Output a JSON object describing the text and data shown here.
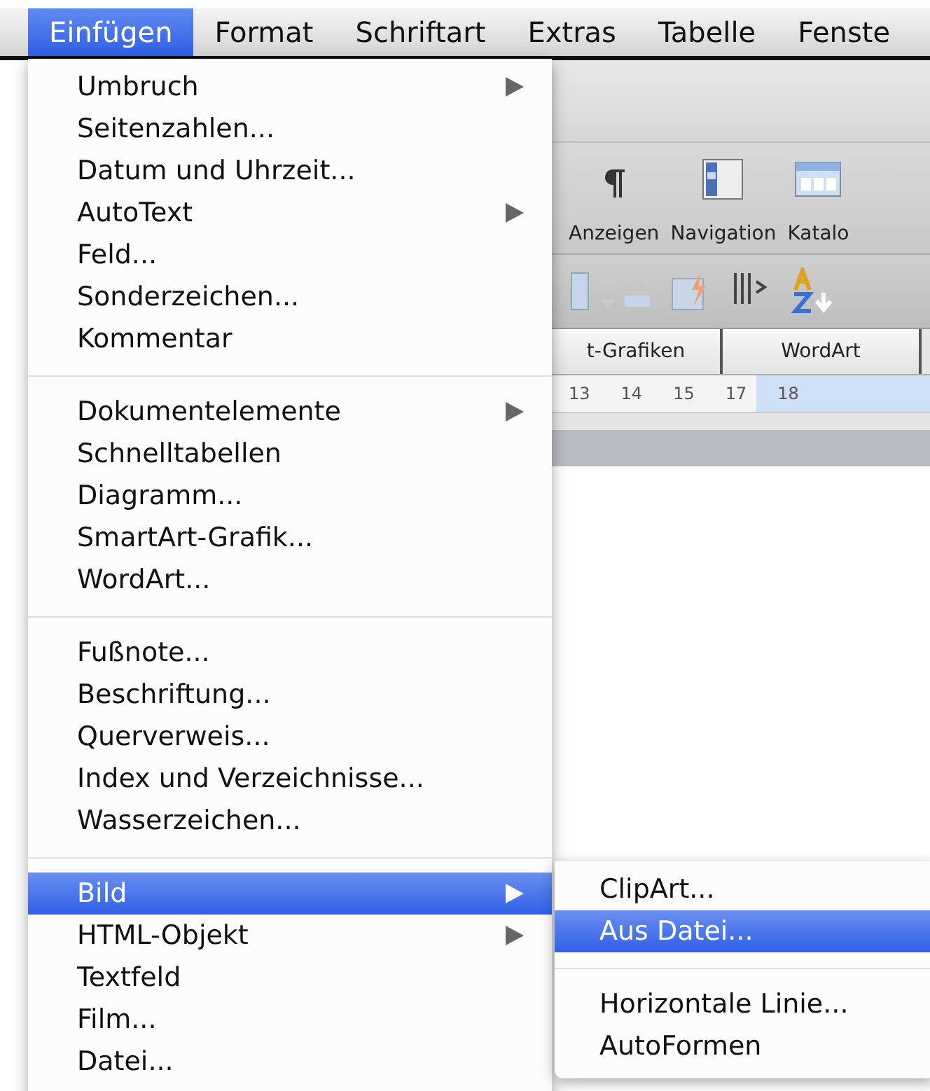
{
  "menubar": [
    {
      "label": "Einfügen",
      "selected": true
    },
    {
      "label": "Format",
      "selected": false
    },
    {
      "label": "Schriftart",
      "selected": false
    },
    {
      "label": "Extras",
      "selected": false
    },
    {
      "label": "Tabelle",
      "selected": false
    },
    {
      "label": "Fenste",
      "selected": false
    }
  ],
  "ribbon": {
    "buttons": [
      {
        "label": "Anzeigen"
      },
      {
        "label": "Navigation"
      },
      {
        "label": "Katalo"
      }
    ],
    "tabs": [
      "t-Grafiken",
      "WordArt"
    ],
    "ruler": [
      "13",
      "14",
      "15",
      "17",
      "18"
    ]
  },
  "menu": [
    {
      "kind": "item",
      "label": "Umbruch",
      "submenu": true,
      "selected": false
    },
    {
      "kind": "item",
      "label": "Seitenzahlen...",
      "submenu": false,
      "selected": false
    },
    {
      "kind": "item",
      "label": "Datum und Uhrzeit...",
      "submenu": false,
      "selected": false
    },
    {
      "kind": "item",
      "label": "AutoText",
      "submenu": true,
      "selected": false
    },
    {
      "kind": "item",
      "label": "Feld...",
      "submenu": false,
      "selected": false
    },
    {
      "kind": "item",
      "label": "Sonderzeichen...",
      "submenu": false,
      "selected": false
    },
    {
      "kind": "item",
      "label": "Kommentar",
      "submenu": false,
      "selected": false
    },
    {
      "kind": "separator"
    },
    {
      "kind": "item",
      "label": "Dokumentelemente",
      "submenu": true,
      "selected": false
    },
    {
      "kind": "item",
      "label": "Schnelltabellen",
      "submenu": false,
      "selected": false
    },
    {
      "kind": "item",
      "label": "Diagramm...",
      "submenu": false,
      "selected": false
    },
    {
      "kind": "item",
      "label": "SmartArt-Grafik...",
      "submenu": false,
      "selected": false
    },
    {
      "kind": "item",
      "label": "WordArt...",
      "submenu": false,
      "selected": false
    },
    {
      "kind": "separator"
    },
    {
      "kind": "item",
      "label": "Fußnote...",
      "submenu": false,
      "selected": false
    },
    {
      "kind": "item",
      "label": "Beschriftung...",
      "submenu": false,
      "selected": false
    },
    {
      "kind": "item",
      "label": "Querverweis...",
      "submenu": false,
      "selected": false
    },
    {
      "kind": "item",
      "label": "Index und Verzeichnisse...",
      "submenu": false,
      "selected": false
    },
    {
      "kind": "item",
      "label": "Wasserzeichen...",
      "submenu": false,
      "selected": false
    },
    {
      "kind": "separator"
    },
    {
      "kind": "item",
      "label": "Bild",
      "submenu": true,
      "selected": true
    },
    {
      "kind": "item",
      "label": "HTML-Objekt",
      "submenu": true,
      "selected": false
    },
    {
      "kind": "item",
      "label": "Textfeld",
      "submenu": false,
      "selected": false
    },
    {
      "kind": "item",
      "label": "Film...",
      "submenu": false,
      "selected": false
    },
    {
      "kind": "item",
      "label": "Datei...",
      "submenu": false,
      "selected": false
    }
  ],
  "submenu": [
    {
      "kind": "item",
      "label": "ClipArt...",
      "selected": false
    },
    {
      "kind": "item",
      "label": "Aus Datei...",
      "selected": true
    },
    {
      "kind": "separator"
    },
    {
      "kind": "item",
      "label": "Horizontale Linie...",
      "selected": false
    },
    {
      "kind": "item",
      "label": "AutoFormen",
      "selected": false
    }
  ]
}
